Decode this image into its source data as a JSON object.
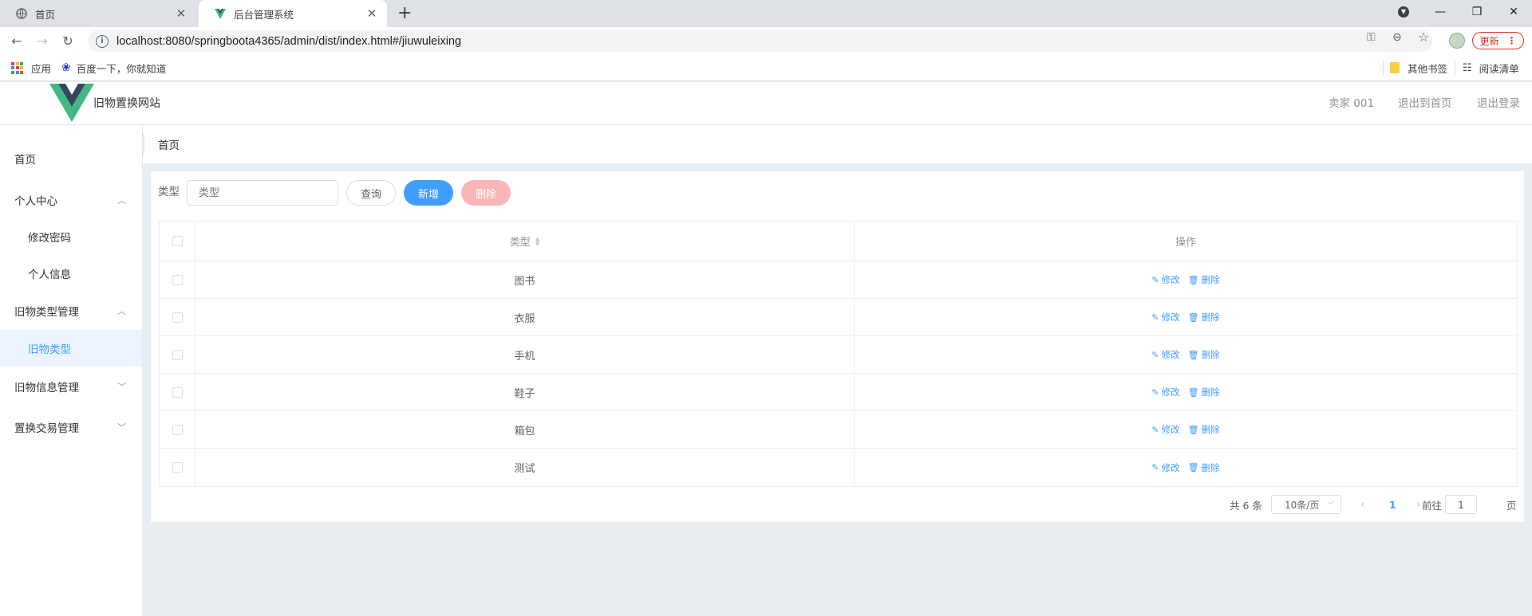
{
  "browser": {
    "tabs": [
      {
        "title": "首页",
        "active": false,
        "icon": "globe-icon"
      },
      {
        "title": "后台管理系统",
        "active": true,
        "icon": "vue-logo-icon"
      }
    ],
    "url": "localhost:8080/springboota4365/admin/dist/index.html#/jiuwuleixing",
    "update_label": "更新",
    "bookmarks": [
      {
        "label": "应用",
        "icon": "apps-grid-icon"
      },
      {
        "label": "百度一下，你就知道",
        "icon": "baidu-paw-icon"
      }
    ],
    "bookmarks_right": [
      {
        "label": "其他书签",
        "icon": "folder-icon"
      },
      {
        "label": "阅读清单",
        "icon": "reading-list-icon"
      }
    ]
  },
  "header": {
    "site_title": "旧物置换网站",
    "user": "卖家 001",
    "back_home": "退出到首页",
    "logout": "退出登录",
    "brand_color": "#42b883"
  },
  "sidebar": {
    "items": [
      {
        "label": "首页",
        "level": 1,
        "arrow": ""
      },
      {
        "label": "个人中心",
        "level": 1,
        "arrow": "up"
      },
      {
        "label": "修改密码",
        "level": 2
      },
      {
        "label": "个人信息",
        "level": 2
      },
      {
        "label": "旧物类型管理",
        "level": 1,
        "arrow": "up"
      },
      {
        "label": "旧物类型",
        "level": 2,
        "active": true
      },
      {
        "label": "旧物信息管理",
        "level": 1,
        "arrow": "down"
      },
      {
        "label": "置换交易管理",
        "level": 1,
        "arrow": "down"
      }
    ]
  },
  "breadcrumb": "首页",
  "search": {
    "label": "类型",
    "placeholder": "类型",
    "query_label": "查询",
    "add_label": "新增",
    "delete_label": "删除"
  },
  "table": {
    "columns": [
      "类型",
      "操作"
    ],
    "rows": [
      "图书",
      "衣服",
      "手机",
      "鞋子",
      "箱包",
      "测试"
    ],
    "edit_label": "修改",
    "delete_label": "删除"
  },
  "pagination": {
    "total_text": "共 6 条",
    "page_size": "10条/页",
    "current_page": "1",
    "goto_prefix": "前往",
    "goto_value": "1",
    "goto_suffix": "页"
  },
  "colors": {
    "primary": "#409eff",
    "danger_disabled": "#fab6b6",
    "update": "#d93025"
  }
}
